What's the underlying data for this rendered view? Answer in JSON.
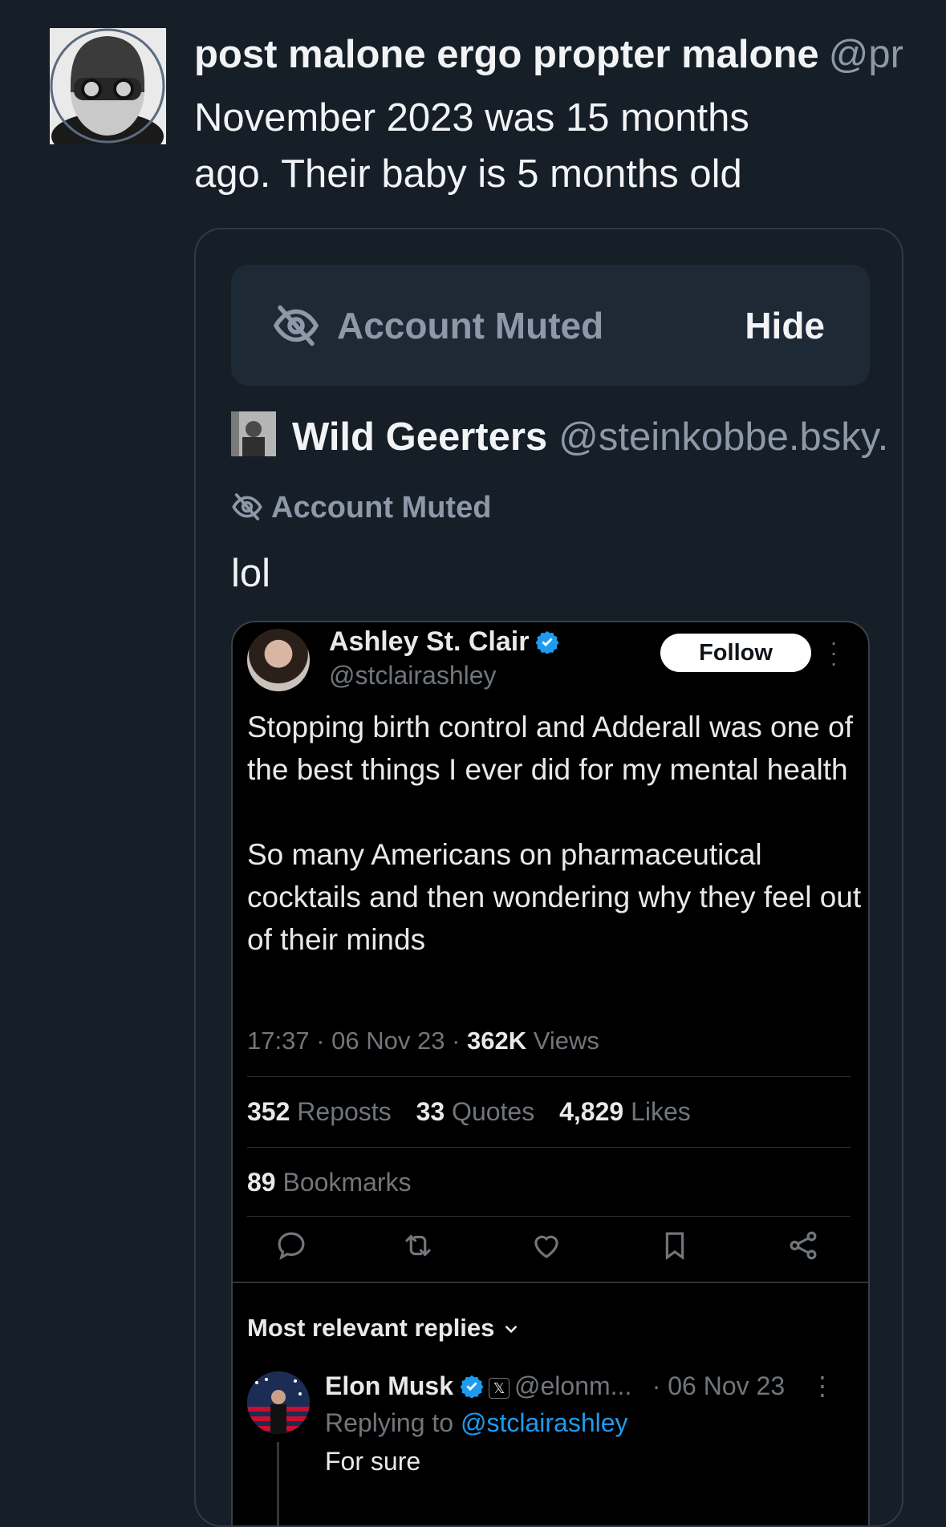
{
  "post": {
    "author_name": "post malone ergo propter malone",
    "author_handle": "@pr",
    "text": "November 2023 was 15 months\nago.  Their baby is 5 months old"
  },
  "quote": {
    "muted_label": "Account Muted",
    "hide_label": "Hide",
    "author_name": "Wild Geerters",
    "author_handle": "@steinkobbe.bsky.",
    "muted_note": "Account Muted",
    "text": "lol"
  },
  "embed": {
    "name": "Ashley St. Clair",
    "handle": "@stclairashley",
    "follow_label": "Follow",
    "text": "Stopping birth control and Adderall was one of the best things I ever did for my mental health\n\nSo many Americans on pharmaceutical cocktails and then wondering why they feel out of their minds",
    "time": "17:37",
    "date": "06 Nov 23",
    "views_count": "362K",
    "views_label": "Views",
    "reposts_count": "352",
    "reposts_label": "Reposts",
    "quotes_count": "33",
    "quotes_label": "Quotes",
    "likes_count": "4,829",
    "likes_label": "Likes",
    "bookmarks_count": "89",
    "bookmarks_label": "Bookmarks",
    "replies_sort": "Most relevant replies",
    "reply": {
      "name": "Elon Musk",
      "handle": "@elonm...",
      "date": "· 06 Nov 23",
      "replying_prefix": "Replying to",
      "replying_to": "@stclairashley",
      "text": "For sure"
    }
  },
  "colors": {
    "background": "#161e27",
    "muted_text": "#8d99a8",
    "twitter_blue": "#1d9bf0"
  },
  "icons": [
    "eye-slash-icon",
    "verified-badge-icon",
    "reply-icon",
    "repost-icon",
    "like-icon",
    "bookmark-icon",
    "share-icon",
    "chevron-down-icon",
    "x-logo-icon"
  ]
}
